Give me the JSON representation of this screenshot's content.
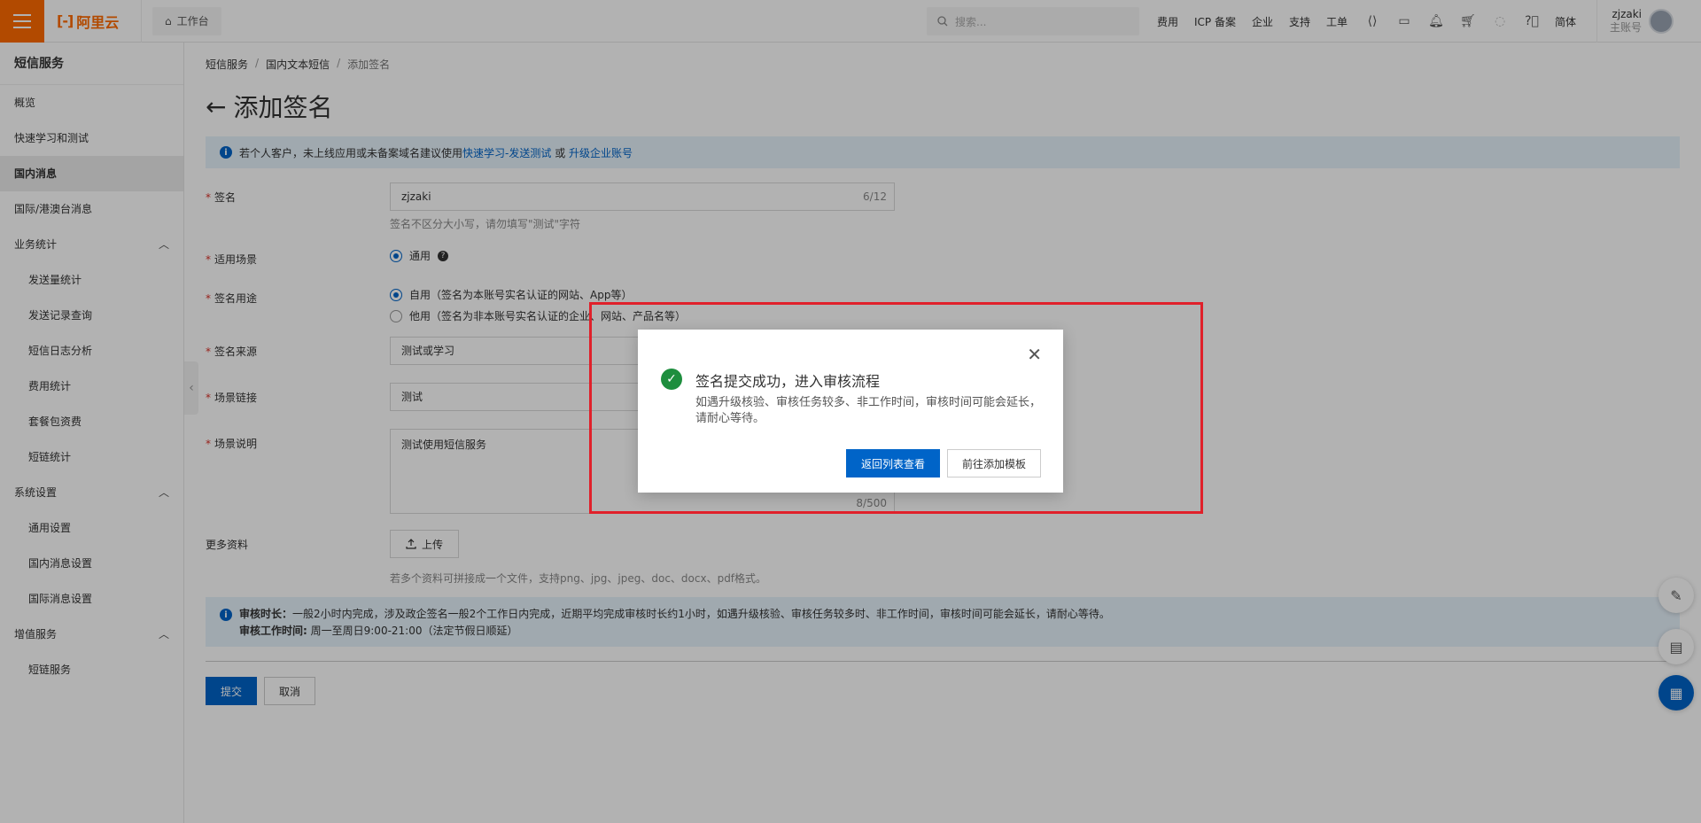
{
  "topbar": {
    "logo_text": "阿里云",
    "workbench": "工作台",
    "search_placeholder": "搜索...",
    "nav": [
      "费用",
      "ICP 备案",
      "企业",
      "支持",
      "工单"
    ],
    "lang": "简体",
    "user_name": "zjzaki",
    "user_role": "主账号"
  },
  "sidebar": {
    "title": "短信服务",
    "items": [
      {
        "label": "概览"
      },
      {
        "label": "快速学习和测试"
      },
      {
        "label": "国内消息"
      },
      {
        "label": "国际/港澳台消息"
      },
      {
        "label": "业务统计"
      },
      {
        "label": "发送量统计"
      },
      {
        "label": "发送记录查询"
      },
      {
        "label": "短信日志分析"
      },
      {
        "label": "费用统计"
      },
      {
        "label": "套餐包资费"
      },
      {
        "label": "短链统计"
      },
      {
        "label": "系统设置"
      },
      {
        "label": "通用设置"
      },
      {
        "label": "国内消息设置"
      },
      {
        "label": "国际消息设置"
      },
      {
        "label": "增值服务"
      },
      {
        "label": "短链服务"
      }
    ]
  },
  "breadcrumb": [
    "短信服务",
    "国内文本短信",
    "添加签名"
  ],
  "page_title": "添加签名",
  "notice": {
    "text": "若个人客户，未上线应用或未备案域名建议使用",
    "link1": "快速学习-发送测试",
    "or": "或",
    "link2": "升级企业账号"
  },
  "form": {
    "sign_label": "签名",
    "sign_value": "zjzaki",
    "sign_count": "6/12",
    "sign_help": "签名不区分大小写，请勿填写\"测试\"字符",
    "scene_label": "适用场景",
    "scene_option": "通用",
    "purpose_label": "签名用途",
    "purpose_self": "自用（签名为本账号实名认证的网站、App等）",
    "purpose_other": "他用（签名为非本账号实名认证的企业、网站、产品名等）",
    "source_label": "签名来源",
    "source_value": "测试或学习",
    "link_label": "场景链接",
    "link_value": "测试",
    "desc_label": "场景说明",
    "desc_value": "测试使用短信服务",
    "desc_count": "8/500",
    "more_label": "更多资料",
    "upload_label": "上传",
    "upload_help": "若多个资料可拼接成一个文件，支持png、jpg、jpeg、doc、docx、pdf格式。"
  },
  "review": {
    "line1_bold": "审核时长：",
    "line1": "一般2小时内完成，涉及政企签名一般2个工作日内完成，近期平均完成审核时长约1小时，如遇升级核验、审核任务较多时、非工作时间，审核时间可能会延长，请耐心等待。",
    "line2_bold": "审核工作时间:",
    "line2": " 周一至周日9:00-21:00（法定节假日顺延）"
  },
  "actions": {
    "submit": "提交",
    "cancel": "取消"
  },
  "modal": {
    "title": "签名提交成功，进入审核流程",
    "body": "如遇升级核验、审核任务较多、非工作时间，审核时间可能会延长，请耐心等待。",
    "primary": "返回列表查看",
    "secondary": "前往添加模板"
  },
  "colors": {
    "brand_orange": "#ff6a00",
    "primary_blue": "#0064c8",
    "success_green": "#1e8e3e",
    "highlight_red": "#e0202a"
  }
}
